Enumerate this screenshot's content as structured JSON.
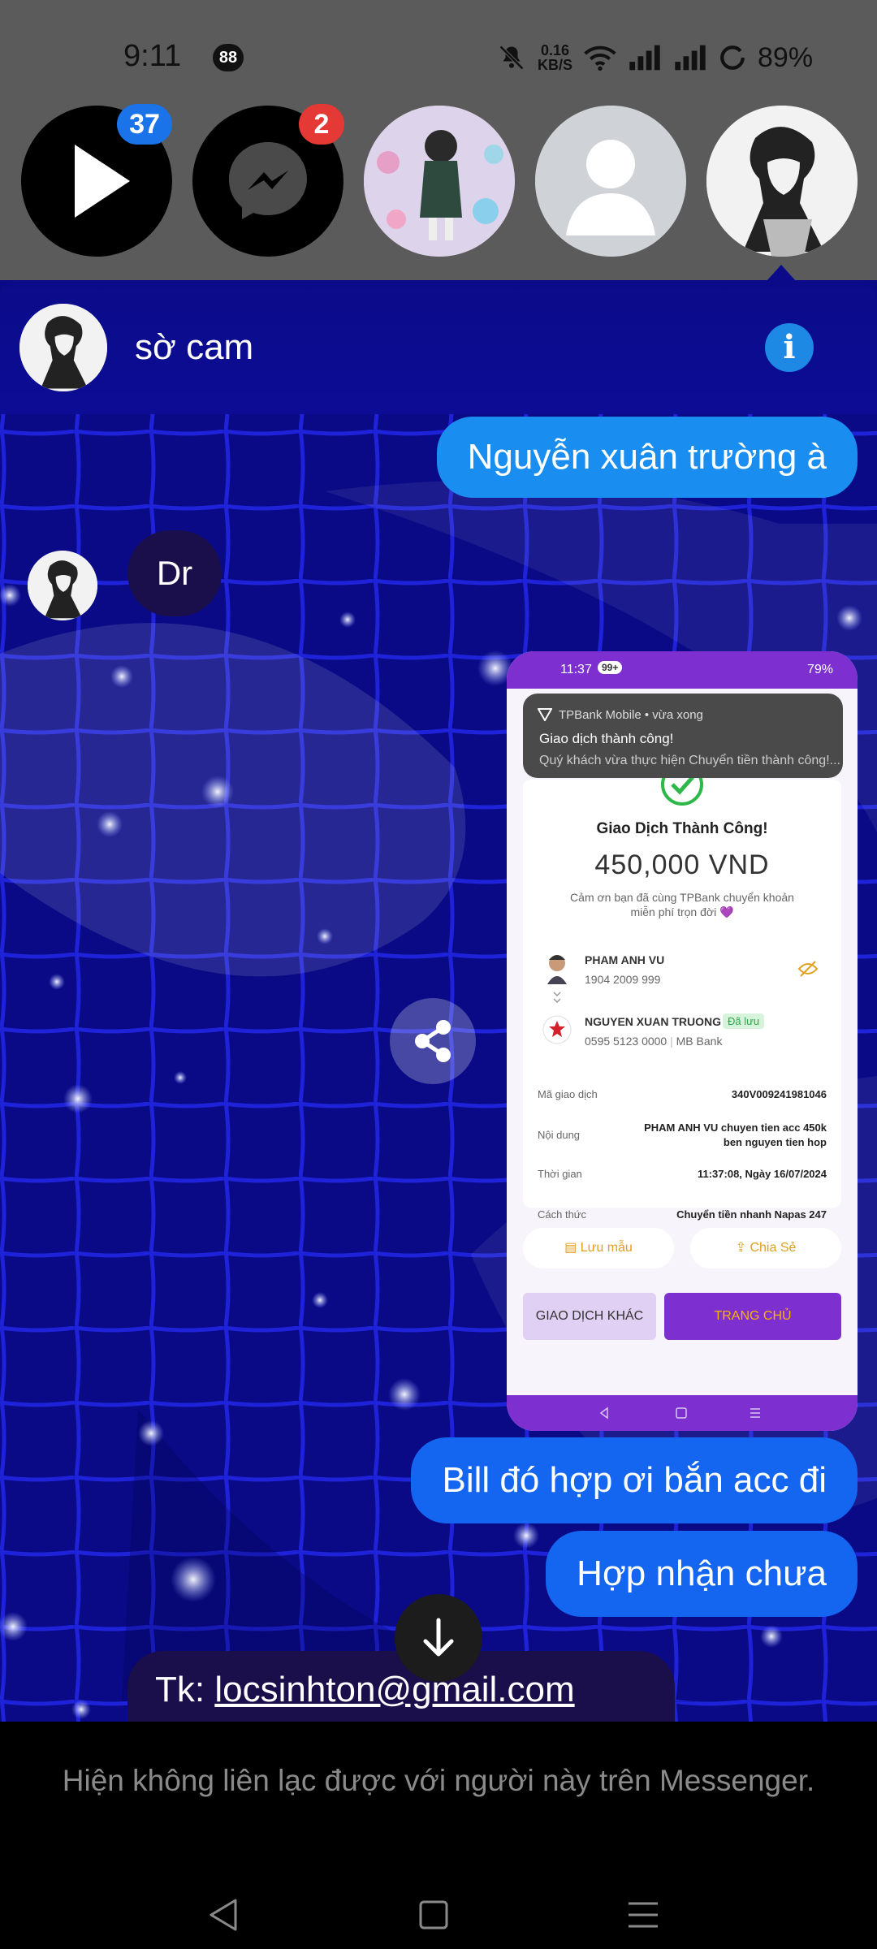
{
  "status_bar": {
    "time": "9:11",
    "notification_count": "88",
    "net_speed_value": "0.16",
    "net_speed_unit": "KB/S",
    "battery": "89%"
  },
  "chat_heads": {
    "video_badge": "37",
    "messenger_badge": "2"
  },
  "header": {
    "contact_name": "sờ cam"
  },
  "messages": {
    "out_1": "Nguyễn xuân trường à",
    "in_1": "Dr",
    "out_2": "Bill đó hợp ơi bắn acc đi",
    "out_3": "Hợp nhận chưa",
    "in_2_prefix": "Tk: ",
    "in_2_email": "locsinhton@gmail.com"
  },
  "receipt": {
    "status_time": "11:37",
    "status_badge": "99+",
    "status_battery": "79%",
    "notif_app": "TPBank Mobile • vừa xong",
    "notif_title": "Giao dịch thành công!",
    "notif_body": "Quý khách vừa thực hiện Chuyển tiền thành công!...",
    "success_title": "Giao Dịch Thành Công!",
    "amount": "450,000 VND",
    "thanks_line1": "Cảm ơn bạn đã cùng TPBank chuyển khoản",
    "thanks_line2": "miễn phí trọn đời 💜",
    "sender_name": "PHAM ANH VU",
    "sender_account": "1904 2009 999",
    "receiver_name": "NGUYEN XUAN TRUONG",
    "receiver_saved": "Đã lưu",
    "receiver_account": "0595 5123 0000",
    "receiver_bank": "MB Bank",
    "rows": [
      {
        "label": "Mã giao dịch",
        "value": "340V009241981046"
      },
      {
        "label": "Nội dung",
        "value": "PHAM ANH VU chuyen tien acc 450k ben nguyen tien hop"
      },
      {
        "label": "Thời gian",
        "value": "11:37:08, Ngày 16/07/2024"
      },
      {
        "label": "Cách thức",
        "value": "Chuyển tiền nhanh Napas 247"
      }
    ],
    "save_template": "Lưu mẫu",
    "share": "Chia Sẻ",
    "other_transaction": "GIAO DỊCH KHÁC",
    "home": "TRANG CHỦ"
  },
  "footer": {
    "unavailable_text": "Hiện không liên lạc được với người này trên Messenger."
  },
  "colors": {
    "chat_bg": "#0a0a86",
    "bubble_light_blue": "#1a8ef0",
    "bubble_blue": "#1466f0",
    "incoming_bubble": "#1a0f4a",
    "info_blue": "#1e88e5",
    "badge_blue": "#1a73e8",
    "badge_red": "#e53935",
    "tpbank_purple": "#7d2fd0",
    "tpbank_gold": "#f8b400"
  },
  "icons": [
    "play-icon",
    "messenger-icon",
    "info-icon",
    "share-icon",
    "arrow-down-icon",
    "back-icon",
    "home-icon",
    "recents-icon"
  ]
}
